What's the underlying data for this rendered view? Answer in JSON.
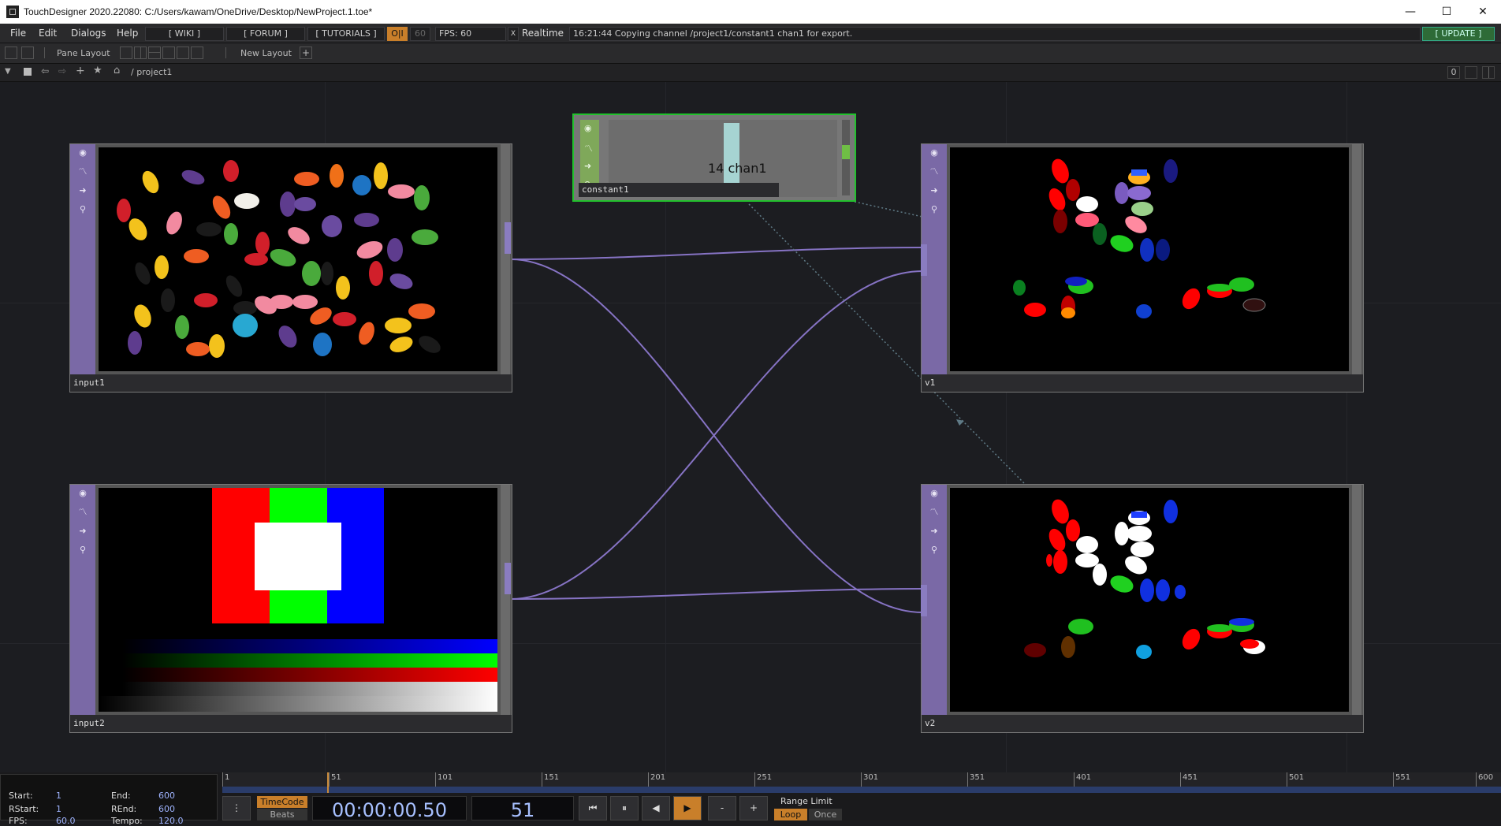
{
  "window": {
    "title": "TouchDesigner 2020.22080: C:/Users/kawam/OneDrive/Desktop/NewProject.1.toe*",
    "minimize": "—",
    "maximize": "☐",
    "close": "✕"
  },
  "menubar": {
    "items": [
      "File",
      "Edit",
      "Dialogs",
      "Help"
    ],
    "wiki": "[ WIKI ]",
    "forum": "[ FORUM ]",
    "tutorials": "[ TUTORIALS ]",
    "oi": "O|I",
    "fps_cap": "60",
    "fps_label": "FPS:",
    "fps_value": "60",
    "realtime_check": "X",
    "realtime": "Realtime",
    "status": "16:21:44 Copying channel /project1/constant1 chan1 for export.",
    "update": "[ UPDATE ]"
  },
  "toolbar": {
    "pane_layout": "Pane Layout",
    "new_layout": "New Layout",
    "add": "+"
  },
  "pathbar": {
    "path": "/ project1",
    "counter": "0"
  },
  "nodes": {
    "input1": {
      "name": "input1"
    },
    "input2": {
      "name": "input2"
    },
    "v1": {
      "name": "v1"
    },
    "v2": {
      "name": "v2"
    },
    "constant1": {
      "name": "constant1",
      "channel_value": "14",
      "channel_name": "chan1"
    }
  },
  "timeline": {
    "ticks": [
      "1",
      "51",
      "101",
      "151",
      "201",
      "251",
      "301",
      "351",
      "401",
      "451",
      "501",
      "551",
      "600"
    ],
    "start_label": "Start:",
    "start": "1",
    "end_label": "End:",
    "end": "600",
    "rstart_label": "RStart:",
    "rstart": "1",
    "rend_label": "REnd:",
    "rend": "600",
    "fps_label": "FPS:",
    "fps": "60.0",
    "tempo_label": "Tempo:",
    "tempo": "120.0",
    "timecode_btn": "TimeCode",
    "beats_btn": "Beats",
    "timecode": "00:00:00.50",
    "frame": "51",
    "range_limit": "Range Limit",
    "loop": "Loop",
    "once": "Once",
    "rewind": "⏮",
    "pause": "⏸",
    "step_back": "◀",
    "play": "▶",
    "minus": "-",
    "plus": "+",
    "menu": "⋮"
  }
}
